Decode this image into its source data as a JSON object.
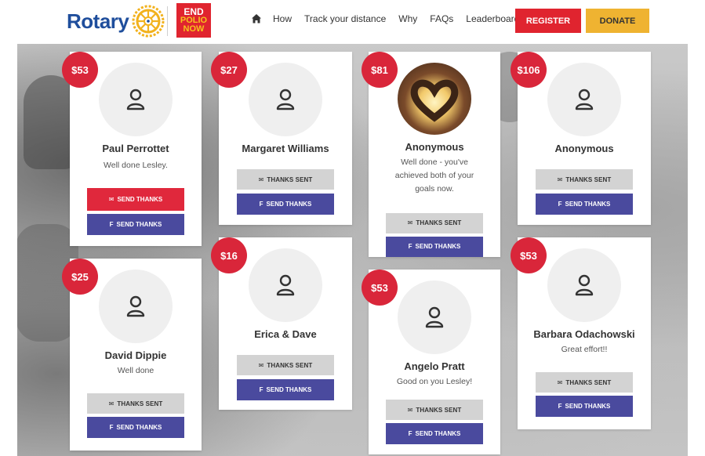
{
  "header": {
    "rotary_word": "Rotary",
    "polio_line1": "END",
    "polio_line2": "POLIO",
    "polio_line3": "NOW",
    "nav": [
      "How",
      "Track your distance",
      "Why",
      "FAQs",
      "Leaderboards"
    ],
    "register_label": "REGISTER",
    "donate_label": "DONATE"
  },
  "labels": {
    "thanks_sent": "THANKS SENT",
    "send_thanks": "SEND THANKS",
    "fb_send_thanks": "SEND THANKS"
  },
  "colors": {
    "brand_red": "#e0242f",
    "donate_yellow": "#efb331",
    "facebook_blue": "#4a4a9e",
    "rotary_blue": "#1f4e9c"
  },
  "cards": [
    {
      "amount": "$53",
      "name": "Paul Perrottet",
      "message": "Well done Lesley.",
      "status": "send"
    },
    {
      "amount": "$27",
      "name": "Margaret Williams",
      "message": "",
      "status": "sent"
    },
    {
      "amount": "$81",
      "name": "Anonymous",
      "message": "Well done - you've achieved both of your goals now.",
      "status": "sent"
    },
    {
      "amount": "$106",
      "name": "Anonymous",
      "message": "",
      "status": "sent"
    },
    {
      "amount": "$25",
      "name": "David Dippie",
      "message": "Well done",
      "status": "sent"
    },
    {
      "amount": "$16",
      "name": "Erica & Dave",
      "message": "",
      "status": "sent"
    },
    {
      "amount": "$53",
      "name": "Angelo Pratt",
      "message": "Good on you Lesley!",
      "status": "sent"
    },
    {
      "amount": "$53",
      "name": "Barbara Odachowski",
      "message": "Great effort!!",
      "status": "sent"
    }
  ]
}
